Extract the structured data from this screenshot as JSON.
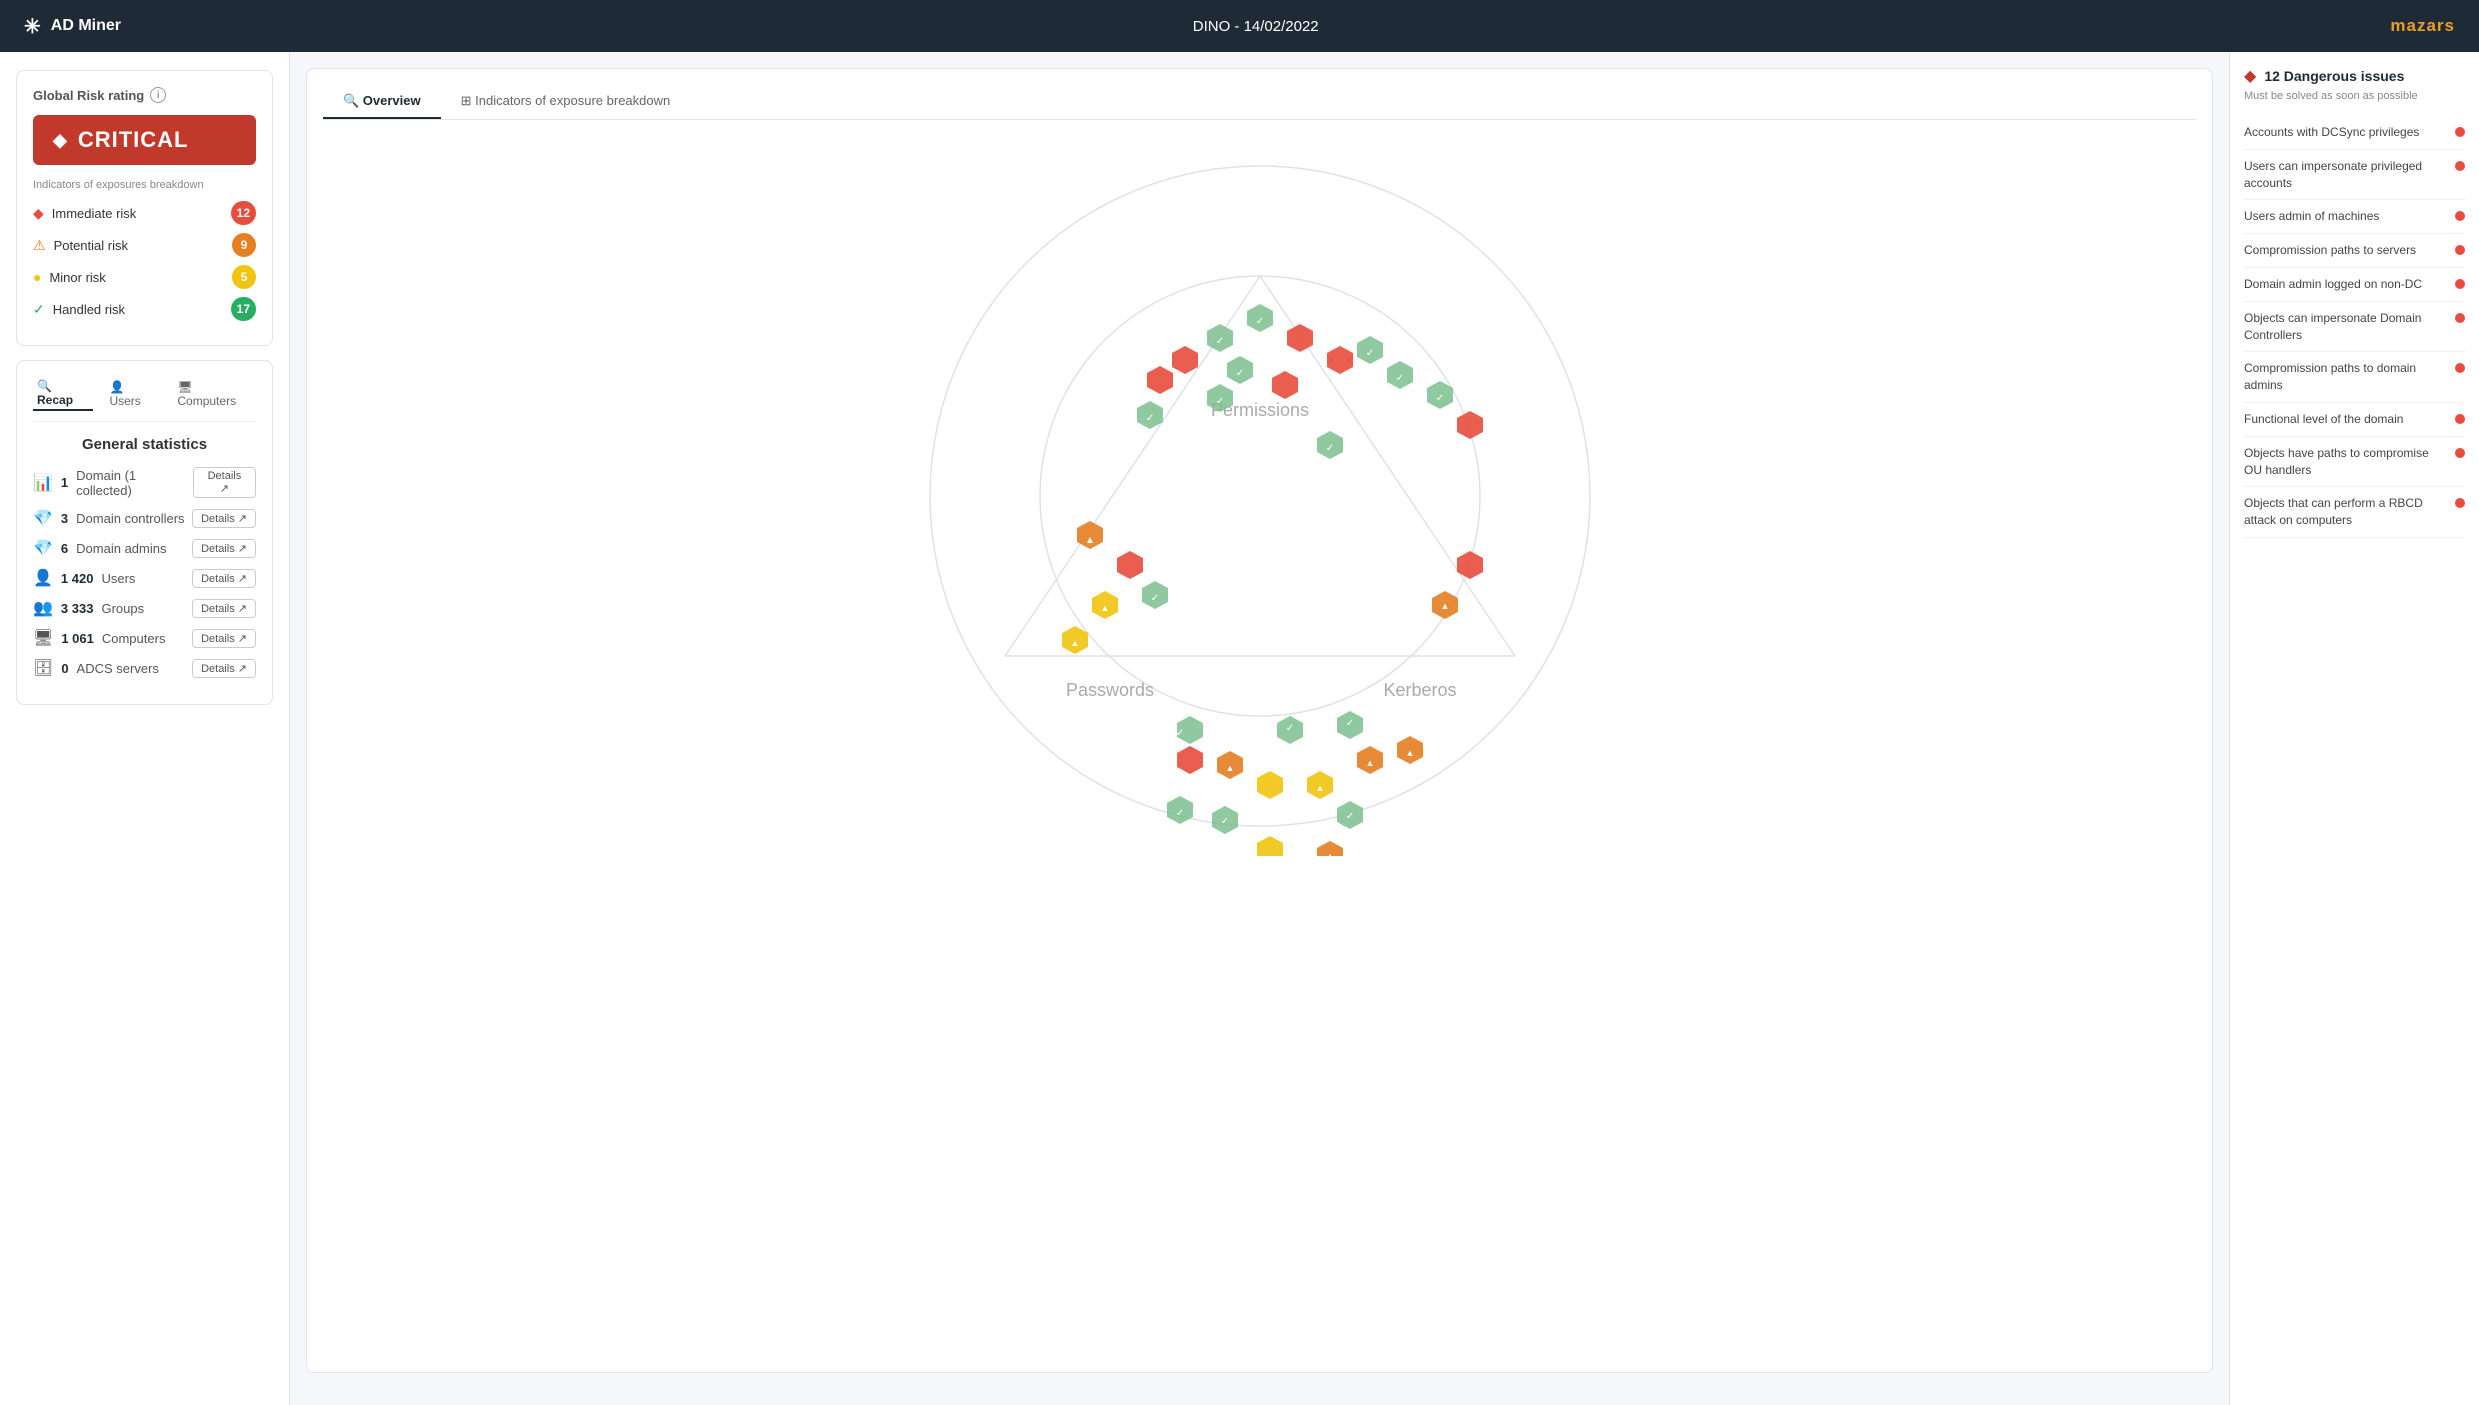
{
  "topnav": {
    "logo_label": "AD Miner",
    "title": "DINO - 14/02/2022",
    "brand": "mazars"
  },
  "left_panel": {
    "global_risk_title": "Global Risk rating",
    "critical_label": "CRITICAL",
    "exposures_subtitle": "Indicators of exposures breakdown",
    "risk_items": [
      {
        "label": "Immediate risk",
        "count": 12,
        "color": "#e74c3c",
        "symbol": "◆"
      },
      {
        "label": "Potential risk",
        "count": 9,
        "color": "#e67e22",
        "symbol": "⚠"
      },
      {
        "label": "Minor risk",
        "count": 5,
        "color": "#f1c40f",
        "symbol": "●"
      },
      {
        "label": "Handled risk",
        "count": 17,
        "color": "#27ae60",
        "symbol": "✓"
      }
    ],
    "tabs": [
      {
        "label": "Recap",
        "icon": "🔍",
        "active": true
      },
      {
        "label": "Users",
        "icon": "👤",
        "active": false
      },
      {
        "label": "Computers",
        "icon": "🖥",
        "active": false
      }
    ],
    "stats_title": "General statistics",
    "stats": [
      {
        "label": "Domain (1 collected)",
        "num": "1",
        "icon": "📊"
      },
      {
        "label": "Domain controllers",
        "num": "3",
        "icon": "💎"
      },
      {
        "label": "Domain admins",
        "num": "6",
        "icon": "💎"
      },
      {
        "label": "Users",
        "num": "1 420",
        "icon": "👤"
      },
      {
        "label": "Groups",
        "num": "3 333",
        "icon": "👥"
      },
      {
        "label": "Computers",
        "num": "1 061",
        "icon": "🖥"
      },
      {
        "label": "ADCS servers",
        "num": "0",
        "icon": "🗄"
      }
    ],
    "details_label": "Details ↗"
  },
  "main_panel": {
    "tabs": [
      {
        "label": "Overview",
        "icon": "🔍",
        "active": true
      },
      {
        "label": "Indicators of exposure breakdown",
        "icon": "⊞",
        "active": false
      }
    ],
    "viz_labels": {
      "permissions": "Permissions",
      "passwords": "Passwords",
      "kerberos": "Kerberos"
    }
  },
  "right_panel": {
    "header": "12 Dangerous issues",
    "subtitle": "Must be solved as soon as possible",
    "issues": [
      {
        "text": "Accounts with DCSync privileges"
      },
      {
        "text": "Users can impersonate privileged accounts"
      },
      {
        "text": "Users admin of machines"
      },
      {
        "text": "Compromission paths to servers"
      },
      {
        "text": "Domain admin logged on non-DC"
      },
      {
        "text": "Objects can impersonate Domain Controllers"
      },
      {
        "text": "Compromission paths to domain admins"
      },
      {
        "text": "Functional level of the domain"
      },
      {
        "text": "Objects have paths to compromise OU handlers"
      },
      {
        "text": "Objects that can perform a RBCD attack on computers"
      }
    ]
  }
}
